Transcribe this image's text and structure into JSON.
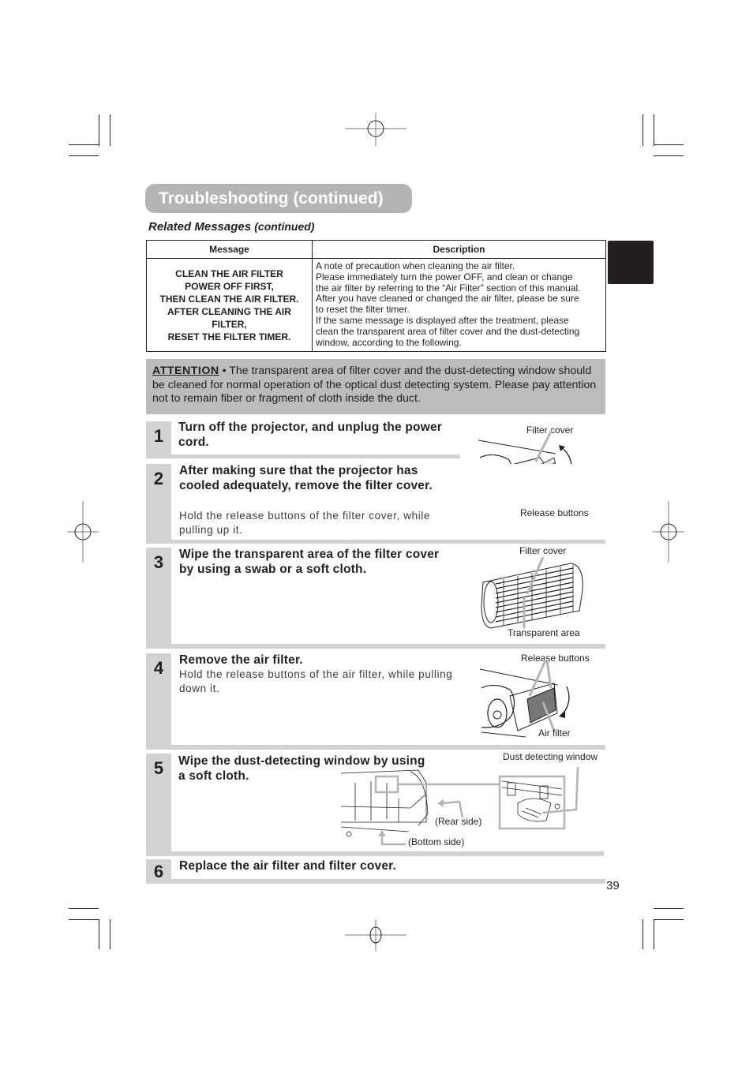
{
  "page": {
    "title": "Troubleshooting (continued)",
    "subheading": {
      "main": "Related Messages",
      "suffix": "(continued)"
    },
    "page_number": "39"
  },
  "table": {
    "headers": [
      "Message",
      "Description"
    ],
    "rows": [
      {
        "message_lines": [
          "CLEAN THE AIR FILTER",
          "POWER OFF FIRST,",
          "THEN CLEAN THE AIR FILTER.",
          "AFTER CLEANING THE AIR",
          "FILTER,",
          "RESET THE FILTER TIMER."
        ],
        "description_lines": [
          "A note of precaution when cleaning the air filter.",
          "Please immediately turn the power OFF, and clean or change",
          "the air filter by referring to the “Air Filter” section of this manual.",
          "After you have cleaned or changed the air filter, please be sure",
          "to reset the filter timer.",
          "If the same message is displayed after the treatment, please",
          "clean the transparent area of filter cover and the dust-detecting",
          "window, according to the following."
        ]
      }
    ]
  },
  "attention": {
    "label": "ATTENTION",
    "text": "• The transparent area of filter cover and the dust-detecting window should be cleaned for normal operation of the optical dust detecting system. Please pay attention not to remain fiber or fragment of cloth inside the duct."
  },
  "steps": [
    {
      "number": "1",
      "title": "Turn off the projector, and unplug the power cord.",
      "detail": ""
    },
    {
      "number": "2",
      "title": "After making sure that the projector has cooled adequately, remove the filter cover.",
      "detail": "Hold the release buttons of the filter cover, while pulling up it.",
      "figure_labels": [
        "Filter cover",
        "Release buttons"
      ]
    },
    {
      "number": "3",
      "title": "Wipe the transparent area of the filter cover by using a swab or a soft cloth.",
      "detail": "",
      "figure_labels": [
        "Filter cover",
        "Transparent area"
      ]
    },
    {
      "number": "4",
      "title": "Remove the air filter.",
      "detail": "Hold the release buttons of the air filter, while pulling down it.",
      "figure_labels": [
        "Release buttons",
        "Air filter"
      ]
    },
    {
      "number": "5",
      "title": "Wipe the dust-detecting window by using a soft cloth.",
      "detail": "",
      "figure_labels": [
        "Dust detecting window",
        "(Rear side)",
        "(Bottom side)"
      ]
    },
    {
      "number": "6",
      "title": "Replace the air filter and filter cover.",
      "detail": ""
    }
  ]
}
